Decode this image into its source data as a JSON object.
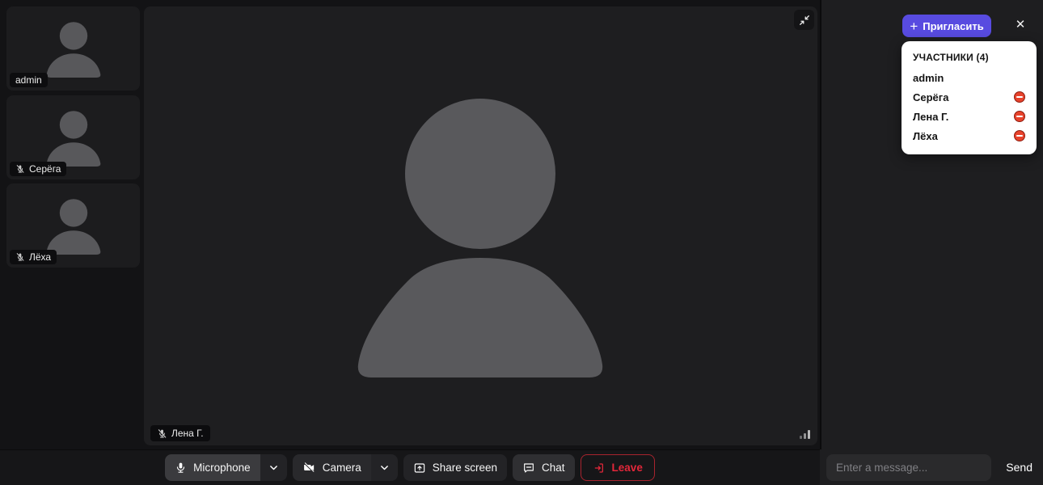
{
  "sidebar": {
    "tiles": [
      {
        "name": "admin",
        "mic_muted": false
      },
      {
        "name": "Серёга",
        "mic_muted": true
      },
      {
        "name": "Лёха",
        "mic_muted": true
      }
    ]
  },
  "stage": {
    "speaker_name": "Лена Г.",
    "mic_muted": true
  },
  "toolbar": {
    "microphone_label": "Microphone",
    "camera_label": "Camera",
    "share_screen_label": "Share screen",
    "chat_label": "Chat",
    "leave_label": "Leave"
  },
  "panel": {
    "invite_button_label": "Пригласить",
    "invite_plus": "+",
    "close_glyph": "✕",
    "participants": {
      "header": "УЧАСТНИКИ (4)",
      "items": [
        {
          "name": "admin",
          "removable": false
        },
        {
          "name": "Серёга",
          "removable": true
        },
        {
          "name": "Лена Г.",
          "removable": true
        },
        {
          "name": "Лёха",
          "removable": true
        }
      ]
    },
    "chat_input_placeholder": "Enter a message...",
    "send_label": "Send"
  },
  "colors": {
    "accent_purple": "#584be0",
    "danger_red": "#e3273a",
    "remove_red": "#e8432c",
    "card_bg": "#ffffff",
    "surface": "#1e1e20"
  }
}
